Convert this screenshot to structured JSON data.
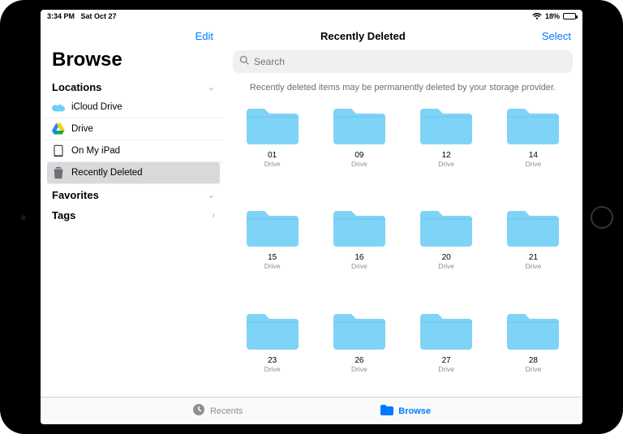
{
  "status": {
    "time": "3:34 PM",
    "date": "Sat Oct 27",
    "battery_pct": "18%"
  },
  "topbar": {
    "edit": "Edit",
    "title": "Recently Deleted",
    "select": "Select"
  },
  "sidebar": {
    "browse": "Browse",
    "locations_label": "Locations",
    "favorites_label": "Favorites",
    "tags_label": "Tags",
    "items": [
      {
        "label": "iCloud Drive"
      },
      {
        "label": "Drive"
      },
      {
        "label": "On My iPad"
      },
      {
        "label": "Recently Deleted"
      }
    ]
  },
  "search": {
    "placeholder": "Search"
  },
  "notice": "Recently deleted items may be permanently deleted by your storage provider.",
  "folders": [
    {
      "name": "01",
      "sub": "Drive"
    },
    {
      "name": "09",
      "sub": "Drive"
    },
    {
      "name": "12",
      "sub": "Drive"
    },
    {
      "name": "14",
      "sub": "Drive"
    },
    {
      "name": "15",
      "sub": "Drive"
    },
    {
      "name": "16",
      "sub": "Drive"
    },
    {
      "name": "20",
      "sub": "Drive"
    },
    {
      "name": "21",
      "sub": "Drive"
    },
    {
      "name": "23",
      "sub": "Drive"
    },
    {
      "name": "26",
      "sub": "Drive"
    },
    {
      "name": "27",
      "sub": "Drive"
    },
    {
      "name": "28",
      "sub": "Drive"
    }
  ],
  "tabs": {
    "recents": "Recents",
    "browse": "Browse"
  },
  "colors": {
    "accent": "#007aff",
    "folder": "#7fd3f7"
  }
}
